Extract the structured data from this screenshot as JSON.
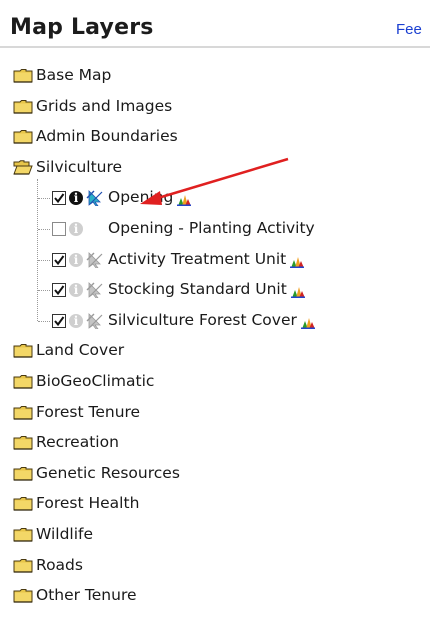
{
  "panel": {
    "title": "Map Layers",
    "feedback_link": "Fee"
  },
  "colors": {
    "folder_fill": "#e8c64a",
    "arrow": "#e02020",
    "link": "#1a3fd1"
  },
  "folders_top": [
    {
      "label": "Base Map",
      "icon": "folder-closed-icon"
    },
    {
      "label": "Grids and Images",
      "icon": "folder-closed-icon"
    },
    {
      "label": "Admin Boundaries",
      "icon": "folder-closed-icon"
    }
  ],
  "open_folder": {
    "label": "Silviculture",
    "icon": "folder-open-icon",
    "layers": [
      {
        "label": "Opening",
        "checked": true,
        "info_active": true,
        "selectable": true,
        "legend": true
      },
      {
        "label": "Opening - Planting Activity",
        "checked": false,
        "info_active": false,
        "selectable": false,
        "legend": false
      },
      {
        "label": "Activity Treatment Unit",
        "checked": true,
        "info_active": false,
        "selectable": false,
        "legend": true
      },
      {
        "label": "Stocking Standard Unit",
        "checked": true,
        "info_active": false,
        "selectable": false,
        "legend": true
      },
      {
        "label": "Silviculture Forest Cover",
        "checked": true,
        "info_active": false,
        "selectable": false,
        "legend": true
      }
    ]
  },
  "folders_bottom": [
    {
      "label": "Land Cover",
      "icon": "folder-closed-icon"
    },
    {
      "label": "BioGeoClimatic",
      "icon": "folder-closed-icon"
    },
    {
      "label": "Forest Tenure",
      "icon": "folder-closed-icon"
    },
    {
      "label": "Recreation",
      "icon": "folder-closed-icon"
    },
    {
      "label": "Genetic Resources",
      "icon": "folder-closed-icon"
    },
    {
      "label": "Forest Health",
      "icon": "folder-closed-icon"
    },
    {
      "label": "Wildlife",
      "icon": "folder-closed-icon"
    },
    {
      "label": "Roads",
      "icon": "folder-closed-icon"
    },
    {
      "label": "Other Tenure",
      "icon": "folder-closed-icon"
    }
  ],
  "annotation": {
    "icon": "red-arrow-icon"
  }
}
